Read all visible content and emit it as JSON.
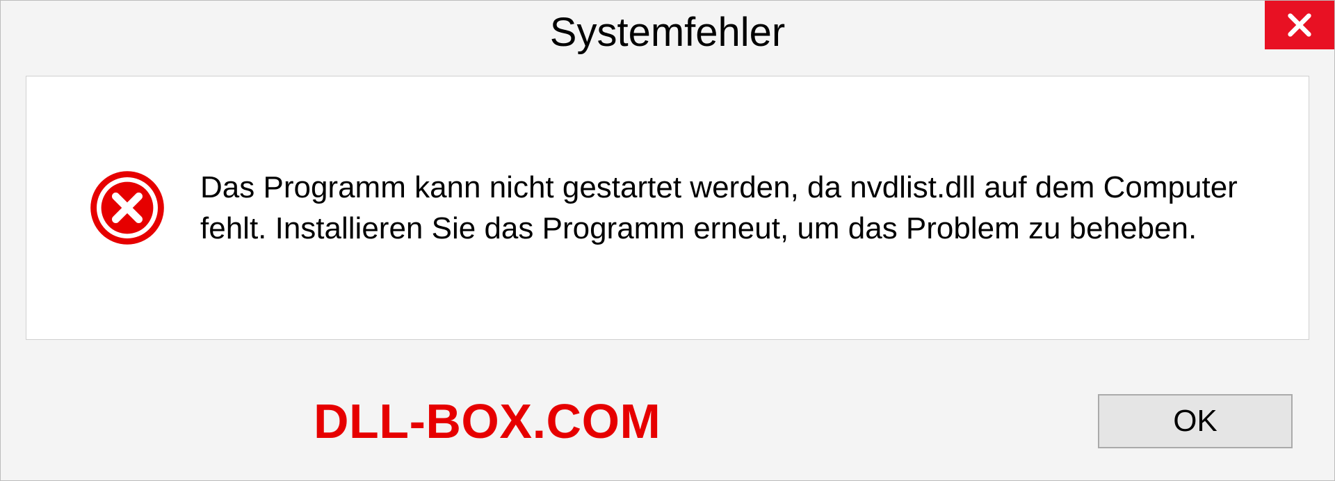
{
  "dialog": {
    "title": "Systemfehler",
    "message": "Das Programm kann nicht gestartet werden, da nvdlist.dll auf dem Computer fehlt. Installieren Sie das Programm erneut, um das Problem zu beheben.",
    "ok_label": "OK"
  },
  "watermark": "DLL-BOX.COM"
}
